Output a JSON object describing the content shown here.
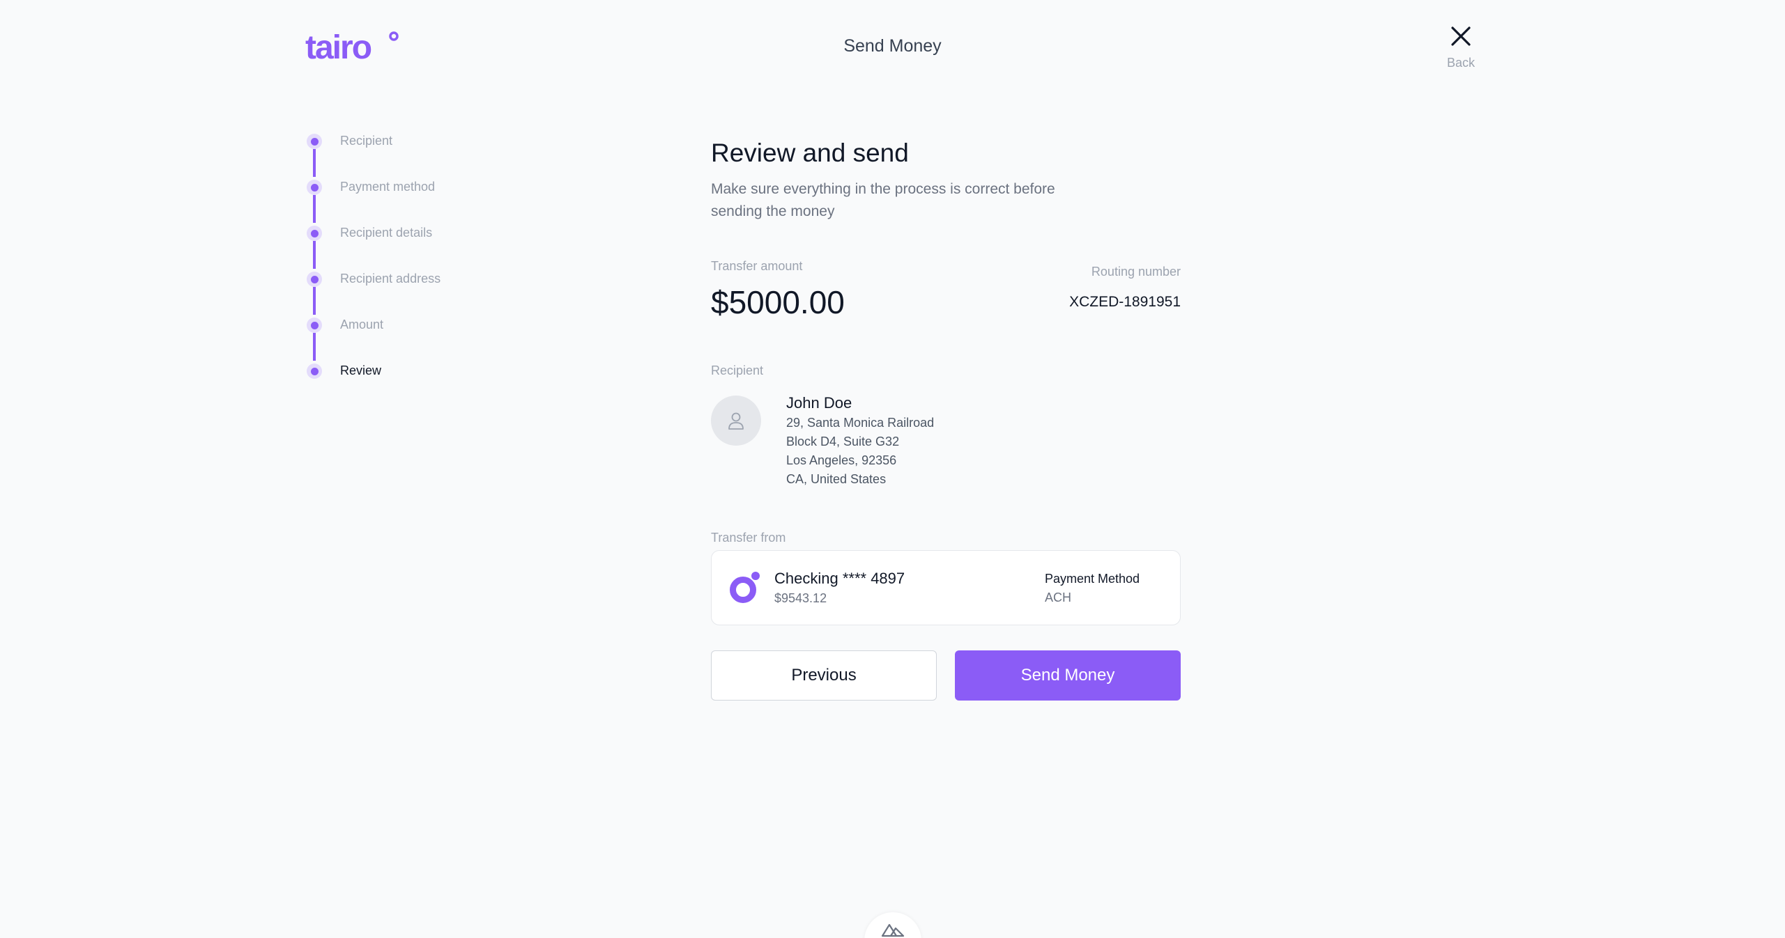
{
  "brand": {
    "logo_text": "tairo",
    "accent_color": "#8b5cf6"
  },
  "header": {
    "title": "Send Money",
    "back_label": "Back",
    "back_icon": "close-icon"
  },
  "stepper": {
    "steps": [
      {
        "label": "Recipient"
      },
      {
        "label": "Payment method"
      },
      {
        "label": "Recipient details"
      },
      {
        "label": "Recipient address"
      },
      {
        "label": "Amount"
      },
      {
        "label": "Review"
      }
    ],
    "current": "Review"
  },
  "review": {
    "heading": "Review and send",
    "subtitle": "Make sure everything in the process is correct before sending the money",
    "transfer_amount_label": "Transfer amount",
    "transfer_amount": "$5000.00",
    "routing_label": "Routing number",
    "routing_number": "XCZED-1891951",
    "recipient_label": "Recipient",
    "recipient": {
      "avatar_icon": "user-icon",
      "name": "John Doe",
      "address": [
        "29, Santa Monica Railroad",
        "Block D4, Suite G32",
        "Los Angeles, 92356",
        "CA, United States"
      ]
    },
    "transfer_from_label": "Transfer from",
    "account": {
      "icon": "tairo-account-icon",
      "name": "Checking **** 4897",
      "balance": "$9543.12",
      "payment_method_label": "Payment Method",
      "payment_method": "ACH"
    }
  },
  "actions": {
    "previous_label": "Previous",
    "send_label": "Send Money"
  }
}
